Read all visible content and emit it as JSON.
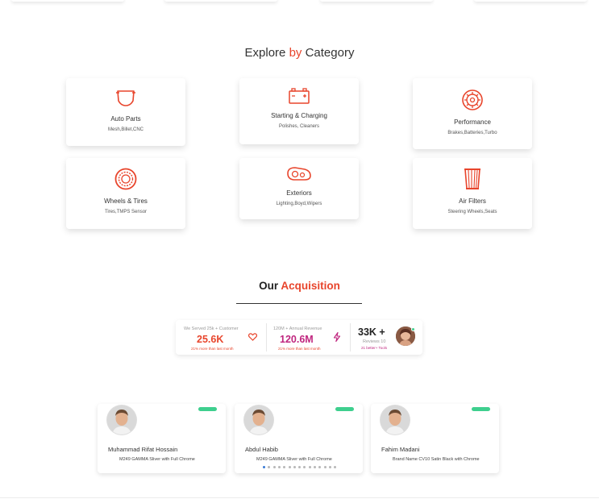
{
  "category_section": {
    "title_part1": "Explore",
    "title_accent": "by",
    "title_part2": "Category",
    "cards": [
      {
        "title": "Auto Parts",
        "subtitle": "Mesh,Billet,CNC",
        "icon": "car-front-icon"
      },
      {
        "title": "Starting & Charging",
        "subtitle": "Polishes, Cleaners",
        "icon": "battery-icon"
      },
      {
        "title": "Performance",
        "subtitle": "Brakes,Batteries,Turbo",
        "icon": "turbo-icon"
      },
      {
        "title": "Wheels & Tires",
        "subtitle": "Tires,TMPS Sensor",
        "icon": "wheel-icon"
      },
      {
        "title": "Exteriors",
        "subtitle": "Lighting,Boyd,Wipers",
        "icon": "headlight-icon"
      },
      {
        "title": "Air Filters",
        "subtitle": "Steering Wheels,Seats",
        "icon": "air-filter-icon"
      }
    ]
  },
  "acquisition": {
    "title_part1": "Our",
    "title_accent": "Acquisition",
    "stats": [
      {
        "label": "We Served 25k + Customer",
        "value": "25.6K",
        "note": "21% more than last month",
        "icon": "heart-icon",
        "color": "#e8452c"
      },
      {
        "label": "120M + Annual Revenue",
        "value": "120.6M",
        "note": "21% more than last month",
        "icon": "lightning-icon",
        "color": "#c0267f"
      },
      {
        "label": "Reviews 10",
        "value": "33K +",
        "note": "21 better+ Tools",
        "icon": "avatar",
        "color": "#222222"
      }
    ]
  },
  "testimonials": [
    {
      "name": "Muhammad Rifat Hossain",
      "product": "M249 GAMMA Sliver with Full Chrome"
    },
    {
      "name": "Abdul Habib",
      "product": "M249 GAMMA Sliver with Full Chrome"
    },
    {
      "name": "Fahim Madani",
      "product": "Brand Name CV10 Satin Black with Chrome"
    }
  ],
  "carousel": {
    "dot_count": 15,
    "active_index": 0
  },
  "colors": {
    "accent": "#e8452c",
    "magenta": "#c0267f",
    "green_pill": "#3ecf8e",
    "active_dot": "#3a7bd5"
  }
}
